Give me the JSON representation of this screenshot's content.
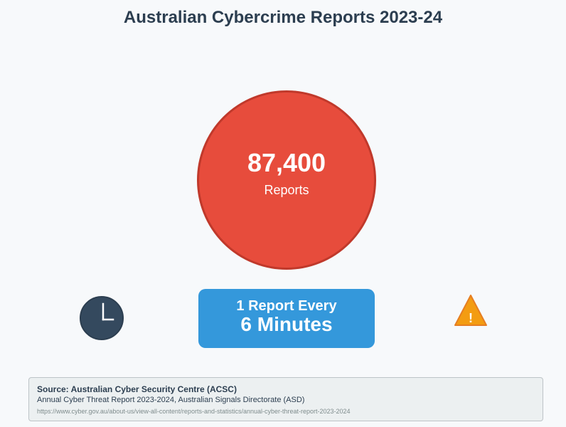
{
  "title": "Australian Cybercrime Reports 2023-24",
  "headline": {
    "number": "87,400",
    "label": "Reports"
  },
  "rate": {
    "line1": "1 Report Every",
    "line2": "6 Minutes"
  },
  "icons": {
    "left": "clock-icon",
    "right": "warning-icon",
    "warning_glyph": "!"
  },
  "source": {
    "title": "Source: Australian Cyber Security Centre (ACSC)",
    "subtitle": "Annual Cyber Threat Report 2023-2024, Australian Signals Directorate (ASD)",
    "url": "https://www.cyber.gov.au/about-us/view-all-content/reports-and-statistics/annual-cyber-threat-report-2023-2024"
  },
  "colors": {
    "background": "#f7f9fb",
    "title": "#2c3e50",
    "circle_fill": "#e74c3c",
    "circle_stroke": "#c0392b",
    "rate_box": "#3498db",
    "clock": "#34495e",
    "warning_fill": "#f39c12",
    "warning_stroke": "#e67e22"
  }
}
